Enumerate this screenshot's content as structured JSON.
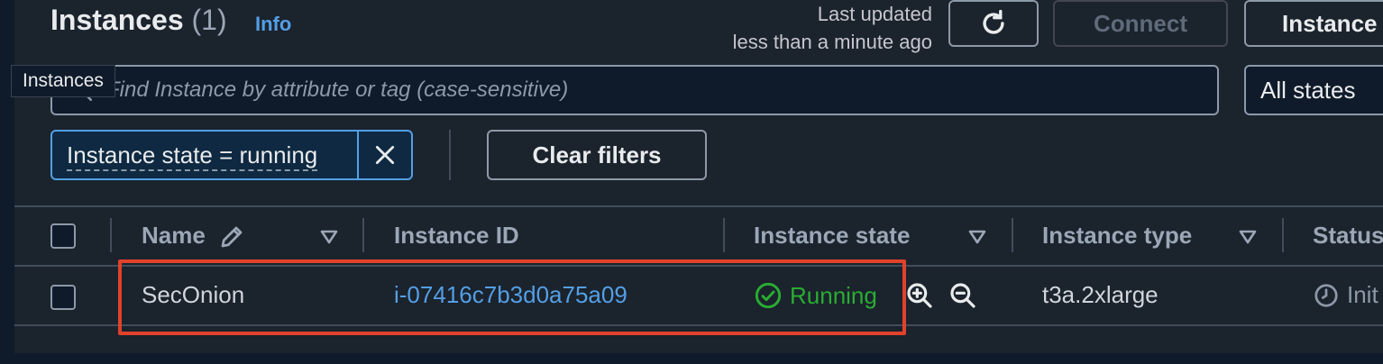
{
  "header": {
    "title": "Instances",
    "count": "(1)",
    "info_link": "Info",
    "last_updated_line1": "Last updated",
    "last_updated_line2": "less than a minute ago",
    "connect_label": "Connect",
    "instance_state_label": "Instance"
  },
  "tooltip": {
    "text": "Instances"
  },
  "search": {
    "placeholder": "Find Instance by attribute or tag (case-sensitive)",
    "value": ""
  },
  "states_select": {
    "value": "All states"
  },
  "filter": {
    "token_label": "Instance state = running",
    "clear_label": "Clear filters"
  },
  "table": {
    "columns": [
      "Name",
      "Instance ID",
      "Instance state",
      "Instance type",
      "Status"
    ],
    "rows": [
      {
        "name": "SecOnion",
        "instance_id": "i-07416c7b3d0a75a09",
        "state": "Running",
        "type": "t3a.2xlarge",
        "status": "Init"
      }
    ]
  },
  "colors": {
    "accent": "#539fe5",
    "running": "#29ad32",
    "highlight": "#e0422b"
  },
  "icons": [
    "refresh-icon",
    "search-icon",
    "close-icon",
    "edit-pencil-icon",
    "sort-down-icon",
    "check-circle-icon",
    "zoom-in-icon",
    "zoom-out-icon",
    "clock-icon"
  ]
}
